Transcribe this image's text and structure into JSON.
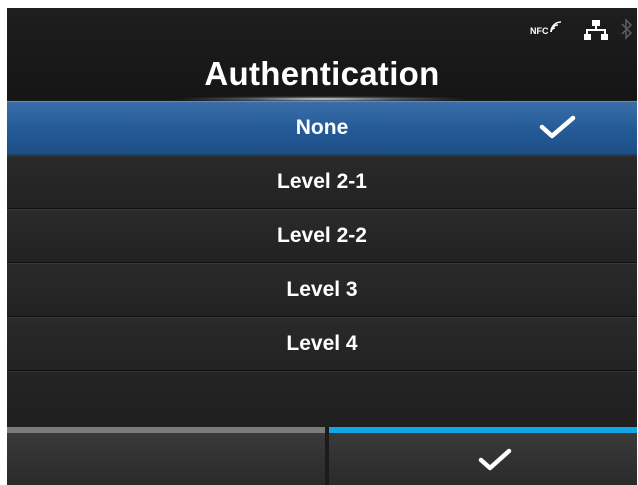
{
  "header": {
    "title": "Authentication",
    "status": {
      "nfc_label": "NFC",
      "icons": [
        "nfc-icon",
        "lan-icon",
        "bluetooth-icon"
      ]
    }
  },
  "options": [
    {
      "label": "None",
      "selected": true
    },
    {
      "label": "Level 2-1",
      "selected": false
    },
    {
      "label": "Level 2-2",
      "selected": false
    },
    {
      "label": "Level 3",
      "selected": false
    },
    {
      "label": "Level 4",
      "selected": false
    }
  ],
  "footer": {
    "left_button_icon": "",
    "right_button_icon": "checkmark-icon"
  },
  "colors": {
    "selected_row": "#235a96",
    "right_button_accent": "#12a6e6",
    "left_button_accent": "#7b7b7b"
  }
}
